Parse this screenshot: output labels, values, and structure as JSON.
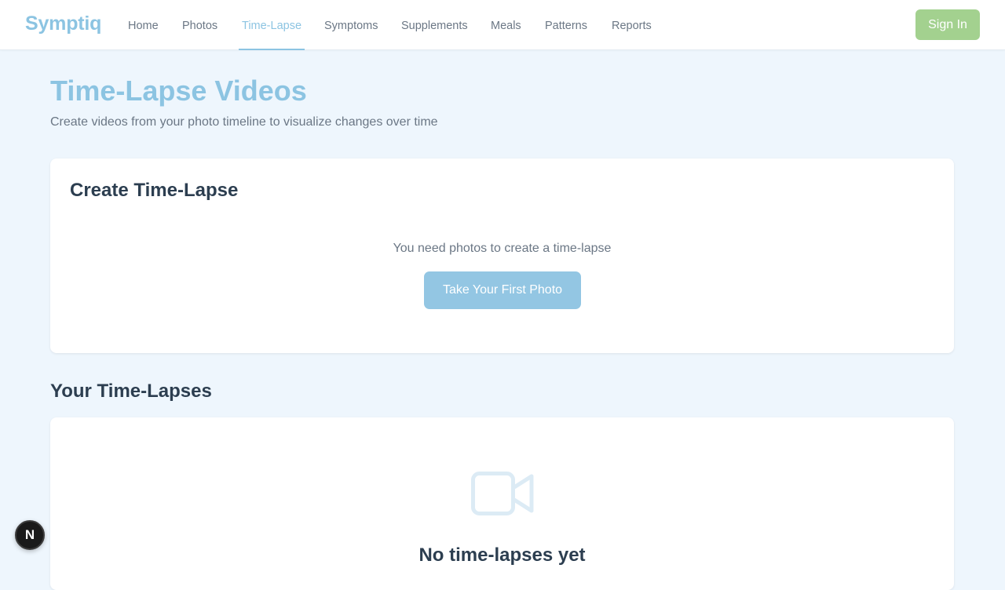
{
  "app": {
    "logo": "Symptiq"
  },
  "nav": {
    "items": [
      {
        "label": "Home"
      },
      {
        "label": "Photos"
      },
      {
        "label": "Time-Lapse",
        "active": true
      },
      {
        "label": "Symptoms"
      },
      {
        "label": "Supplements"
      },
      {
        "label": "Meals"
      },
      {
        "label": "Patterns"
      },
      {
        "label": "Reports"
      }
    ],
    "sign_in": "Sign In"
  },
  "page": {
    "title": "Time-Lapse Videos",
    "subtitle": "Create videos from your photo timeline to visualize changes over time"
  },
  "create_card": {
    "title": "Create Time-Lapse",
    "message": "You need photos to create a time-lapse",
    "button": "Take Your First Photo"
  },
  "list_section": {
    "title": "Your Time-Lapses",
    "empty_icon": "video-camera-icon",
    "empty_title": "No time-lapses yet"
  },
  "dev_badge": {
    "label": "N",
    "icon": "next-js-logo-icon"
  },
  "colors": {
    "accent": "#8cc4e2",
    "primary_button": "#93c6e3",
    "sign_in_button": "#a3d18f",
    "page_background": "#eef6fd",
    "icon_muted": "#dcebf5"
  }
}
